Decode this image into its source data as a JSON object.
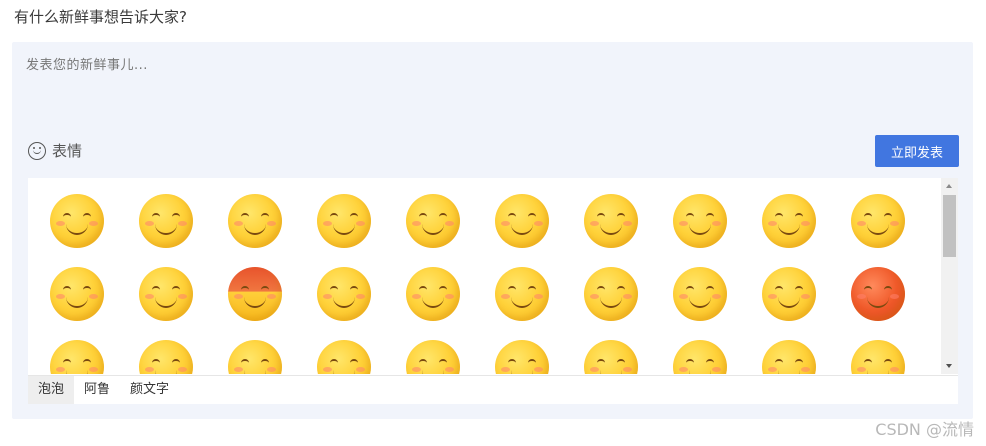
{
  "prompt": "有什么新鲜事想告诉大家?",
  "composer": {
    "placeholder": "发表您的新鲜事儿...",
    "emoji_label": "表情",
    "emoji_icon": "smile-icon",
    "publish_label": "立即发表",
    "publish_color": "#4176e0"
  },
  "emoji_tabs": [
    "泡泡",
    "阿鲁",
    "颜文字"
  ],
  "active_tab": "泡泡",
  "emojis": [
    "smile",
    "laugh-heart",
    "tongue",
    "cover-face",
    "grin-squint",
    "heart-eyes",
    "shy",
    "puppy-eyes",
    "yawn",
    "smirk",
    "smug",
    "frown",
    "angry",
    "sweat",
    "side-eye",
    "crying",
    "think",
    "spit",
    "shocked",
    "red-face",
    "tough",
    "sunglasses",
    "surprised",
    "tired",
    "furious",
    "question",
    "dizzy",
    "scream",
    "annoyed",
    "gasp"
  ],
  "watermark": "CSDN @流情"
}
